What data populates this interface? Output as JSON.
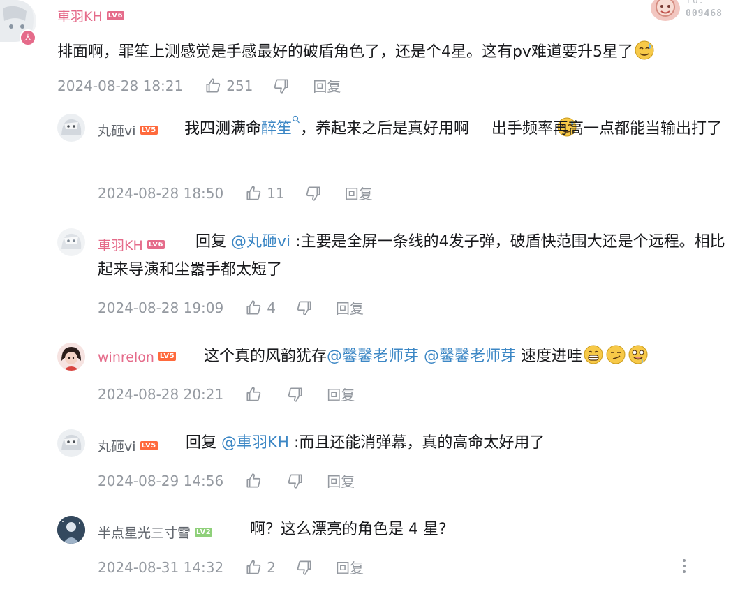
{
  "colors": {
    "name_pink": "#e56b8a",
    "link_blue": "#3c87c5",
    "meta_gray": "#9499a0"
  },
  "top_badge": {
    "label": "LO.",
    "number": "009468"
  },
  "comments": [
    {
      "username": "車羽KH",
      "level": "LV6",
      "avatar_badge": "大",
      "text_before": "排面啊，罪笙上测感觉是手感最好的破盾角色了，还是个4星。这有pv难道要升5星了",
      "time": "2024-08-28 18:21",
      "likes": "251",
      "reply_label": "回复"
    },
    {
      "username": "丸砸vi",
      "level": "LV5",
      "text_before": "我四测满命",
      "search_link": "醉笙",
      "text_after": "，养起来之后是真好用啊",
      "text_end": "出手频率再高一点都能当输出打了",
      "time": "2024-08-28 18:50",
      "likes": "11",
      "reply_label": "回复"
    },
    {
      "username": "車羽KH",
      "level": "LV6",
      "reply_prefix": "回复",
      "mention": "@丸砸vi",
      "text": ":主要是全屏一条线的4发子弹，破盾快范围大还是个远程。相比起来导演和尘嚣手都太短了",
      "time": "2024-08-28 19:09",
      "likes": "4",
      "reply_label": "回复"
    },
    {
      "username": "winrelon",
      "level": "LV5",
      "text_before": "这个真的风韵犹存",
      "mention1": "@馨馨老师芽",
      "mention2": "@馨馨老师芽",
      "text_after": "速度进哇",
      "time": "2024-08-28 20:21",
      "reply_label": "回复"
    },
    {
      "username": "丸砸vi",
      "level": "LV5",
      "reply_prefix": "回复",
      "mention": "@車羽KH",
      "text": ":而且还能消弹幕，真的高命太好用了",
      "time": "2024-08-29 14:56",
      "reply_label": "回复"
    },
    {
      "username": "半点星光三寸雪",
      "level": "LV2",
      "text": "啊？这么漂亮的角色是 4 星?",
      "time": "2024-08-31 14:32",
      "likes": "2",
      "reply_label": "回复"
    }
  ],
  "icons": [
    "thumb-up-icon",
    "thumb-down-icon",
    "more-vertical-icon",
    "search-icon",
    "sweat-emoji-icon",
    "grin-emoji-icon",
    "smirk-emoji-icon",
    "drool-emoji-icon"
  ]
}
